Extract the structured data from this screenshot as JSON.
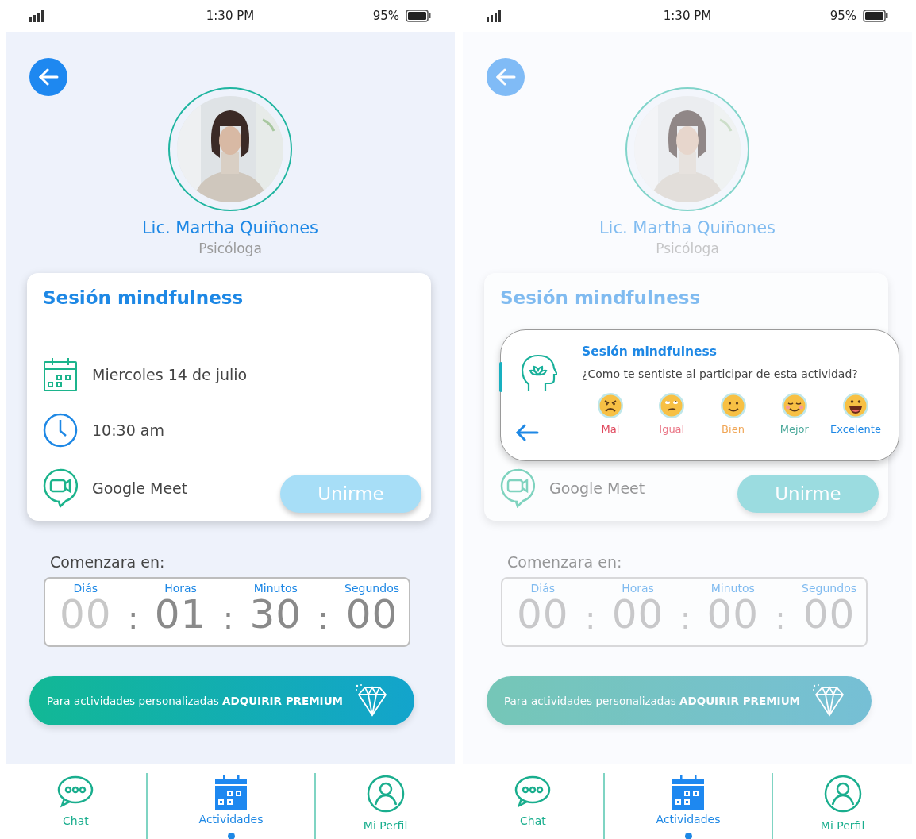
{
  "screens": [
    {
      "status_bar": {
        "time": "1:30 PM",
        "battery": "95%"
      },
      "dimmed": false,
      "profile": {
        "name": "Lic. Martha Quiñones",
        "role": "Psicóloga"
      },
      "session": {
        "title": "Sesión mindfulness",
        "rows": [
          {
            "kind": "date",
            "text": "Miercoles 14 de julio"
          },
          {
            "kind": "time",
            "text": "10:30 am"
          },
          {
            "kind": "meet",
            "text": "Google Meet"
          }
        ],
        "join_button": "Unirme"
      },
      "countdown": {
        "label": "Comenzara en:",
        "separator": ":",
        "units": [
          {
            "label": "Diás",
            "value": "00",
            "faded": true
          },
          {
            "label": "Horas",
            "value": "01",
            "faded": false
          },
          {
            "label": "Minutos",
            "value": "30",
            "faded": false
          },
          {
            "label": "Segundos",
            "value": "00",
            "faded": false
          }
        ]
      },
      "premium": "Para actividades personalizadas **ADQUIRIR PREMIUM**",
      "nav": [
        {
          "kind": "chat",
          "label": "Chat",
          "selected": false
        },
        {
          "kind": "calendar",
          "label": "Actividades",
          "selected": true
        },
        {
          "kind": "profile",
          "label": "Mi Perfil",
          "selected": false
        }
      ]
    },
    {
      "status_bar": {
        "time": "1:30 PM",
        "battery": "95%"
      },
      "dimmed": true,
      "profile": {
        "name": "Lic. Martha Quiñones",
        "role": "Psicóloga"
      },
      "session": {
        "title": "Sesión mindfulness",
        "rows": [
          {
            "kind": "meet",
            "text": "Google Meet"
          }
        ],
        "join_button": "Unirme"
      },
      "countdown": {
        "label": "Comenzara en:",
        "separator": ":",
        "units": [
          {
            "label": "Diás",
            "value": "00"
          },
          {
            "label": "Horas",
            "value": "00"
          },
          {
            "label": "Minutos",
            "value": "00"
          },
          {
            "label": "Segundos",
            "value": "00"
          }
        ]
      },
      "premium": "Para actividades personalizadas **ADQUIRIR PREMIUM**",
      "popup": {
        "title": "Sesión mindfulness",
        "question": "¿Como te sentiste al participar de esta actividad?",
        "ratings": [
          {
            "kind": "angry",
            "label": "Mal",
            "color": "#e0475c"
          },
          {
            "kind": "meh",
            "label": "Igual",
            "color": "#ea7585"
          },
          {
            "kind": "smile",
            "label": "Bien",
            "color": "#f0a656"
          },
          {
            "kind": "content",
            "label": "Mejor",
            "color": "#4aa89a"
          },
          {
            "kind": "grin",
            "label": "Excelente",
            "color": "#1e88e5"
          }
        ]
      },
      "nav": [
        {
          "kind": "chat",
          "label": "Chat",
          "selected": false
        },
        {
          "kind": "calendar",
          "label": "Actividades",
          "selected": true
        },
        {
          "kind": "profile",
          "label": "Mi Perfil",
          "selected": false
        }
      ]
    }
  ]
}
